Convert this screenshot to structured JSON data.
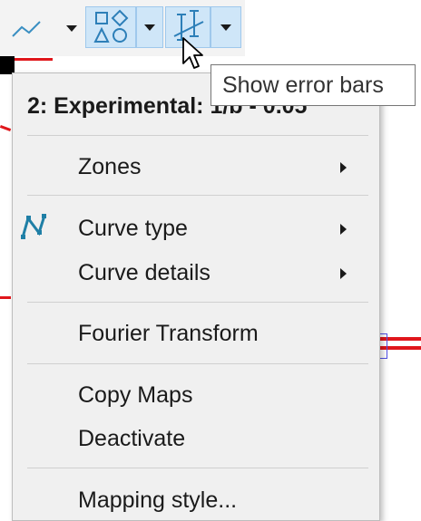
{
  "toolbar": {
    "buttons": [
      {
        "icon": "line-chart-icon"
      },
      {
        "icon": "shapes-icon"
      },
      {
        "icon": "error-bars-icon"
      }
    ]
  },
  "tooltip": {
    "text": "Show error bars"
  },
  "menu": {
    "header": "2: Experimental: 1/b - 0.05",
    "items": [
      {
        "label": "Zones",
        "submenu": true
      },
      {
        "label": "Curve type",
        "submenu": true,
        "icon": "curve-type-icon"
      },
      {
        "label": "Curve details",
        "submenu": true
      },
      {
        "label": "Fourier Transform",
        "submenu": false
      },
      {
        "label": "Copy Maps",
        "submenu": false
      },
      {
        "label": "Deactivate",
        "submenu": false
      },
      {
        "label": "Mapping style...",
        "submenu": false
      }
    ]
  },
  "colors": {
    "plot_line": "#e0161b",
    "marker": "#5050e6",
    "icon_teal": "#1f7fa6",
    "selected_button": "#cfe6f8"
  }
}
